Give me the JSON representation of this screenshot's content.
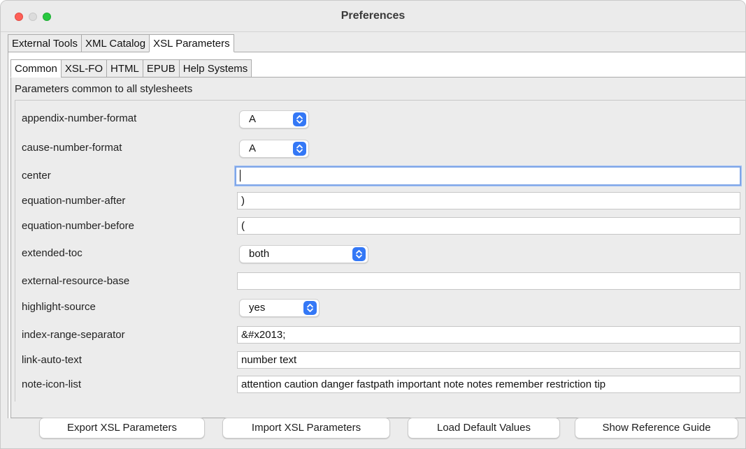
{
  "window": {
    "title": "Preferences"
  },
  "outer_tabs": [
    "External Tools",
    "XML Catalog",
    "XSL Parameters"
  ],
  "inner_tabs": [
    "Common",
    "XSL-FO",
    "HTML",
    "EPUB",
    "Help Systems"
  ],
  "caption": "Parameters common to all stylesheets",
  "params": {
    "appendix_number_format": {
      "label": "appendix-number-format",
      "value": "A"
    },
    "cause_number_format": {
      "label": "cause-number-format",
      "value": "A"
    },
    "center": {
      "label": "center",
      "value": ""
    },
    "equation_number_after": {
      "label": "equation-number-after",
      "value": ")"
    },
    "equation_number_before": {
      "label": "equation-number-before",
      "value": "("
    },
    "extended_toc": {
      "label": "extended-toc",
      "value": "both"
    },
    "external_resource_base": {
      "label": "external-resource-base",
      "value": ""
    },
    "highlight_source": {
      "label": "highlight-source",
      "value": "yes"
    },
    "index_range_separator": {
      "label": "index-range-separator",
      "value": "&#x2013;"
    },
    "link_auto_text": {
      "label": "link-auto-text",
      "value": "number text"
    },
    "note_icon_list": {
      "label": "note-icon-list",
      "value": "attention caution danger fastpath important note notes remember restriction tip"
    }
  },
  "buttons": {
    "export": "Export XSL Parameters",
    "import": "Import XSL Parameters",
    "load_defaults": "Load Default Values",
    "show_guide": "Show Reference Guide"
  },
  "colors": {
    "accent": "#3478f6",
    "focus_ring": "#7fa6e8"
  }
}
